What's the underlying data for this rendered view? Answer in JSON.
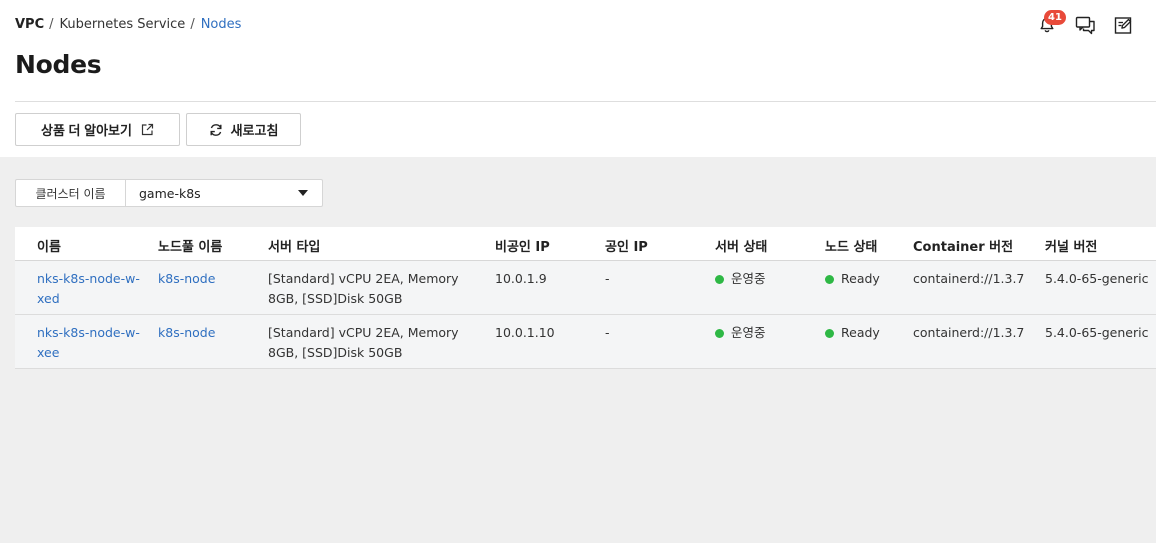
{
  "breadcrumb": {
    "vpc": "VPC",
    "service": "Kubernetes Service",
    "current": "Nodes",
    "sep": "/"
  },
  "page": {
    "title": "Nodes"
  },
  "header_icons": {
    "notification_count": "41"
  },
  "buttons": {
    "learn_more": "상품 더 알아보기",
    "refresh": "새로고침"
  },
  "filter": {
    "label": "클러스터 이름",
    "selected": "game-k8s"
  },
  "table": {
    "headers": [
      "이름",
      "노드풀 이름",
      "서버 타입",
      "비공인 IP",
      "공인 IP",
      "서버 상태",
      "노드 상태",
      "Container 버전",
      "커널 버전"
    ],
    "rows": [
      {
        "name": "nks-k8s-node-w-xed",
        "nodepool": "k8s-node",
        "server_type": "[Standard] vCPU 2EA, Memory 8GB, [SSD]Disk 50GB",
        "private_ip": "10.0.1.9",
        "public_ip": "-",
        "server_status": "운영중",
        "node_status": "Ready",
        "container_version": "containerd://1.3.7",
        "kernel_version": "5.4.0-65-generic"
      },
      {
        "name": "nks-k8s-node-w-xee",
        "nodepool": "k8s-node",
        "server_type": "[Standard] vCPU 2EA, Memory 8GB, [SSD]Disk 50GB",
        "private_ip": "10.0.1.10",
        "public_ip": "-",
        "server_status": "운영중",
        "node_status": "Ready",
        "container_version": "containerd://1.3.7",
        "kernel_version": "5.4.0-65-generic"
      }
    ]
  },
  "colors": {
    "link": "#2f6fc0",
    "status_green": "#2eb845",
    "badge_red": "#e84a3a"
  }
}
